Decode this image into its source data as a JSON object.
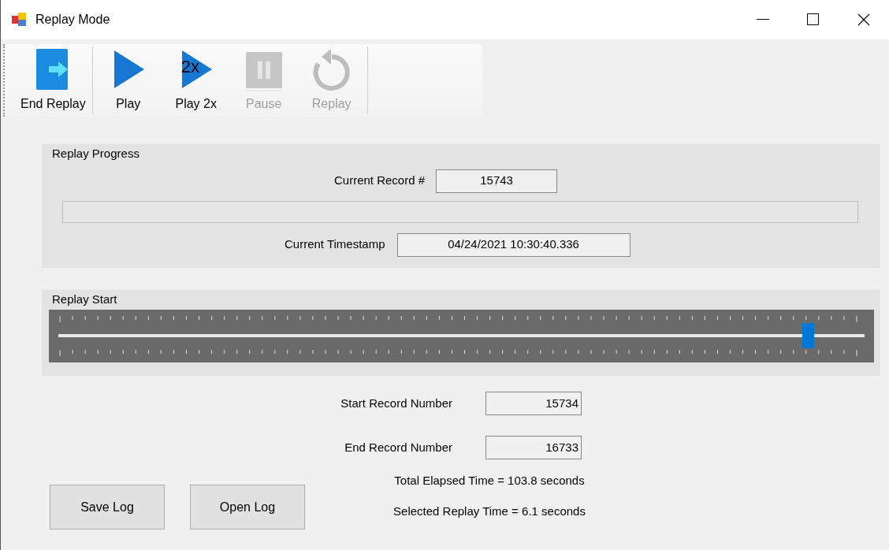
{
  "window": {
    "title": "Replay Mode"
  },
  "toolbar": [
    {
      "kind": "exit",
      "label": "End Replay",
      "disabled": false
    },
    {
      "kind": "play",
      "label": "Play",
      "disabled": false
    },
    {
      "kind": "fast",
      "label": "Play 2x",
      "icon_text": "2x",
      "disabled": false
    },
    {
      "kind": "pause",
      "label": "Pause",
      "disabled": true
    },
    {
      "kind": "replay",
      "label": "Replay",
      "disabled": true
    }
  ],
  "replay_progress": {
    "title": "Replay Progress",
    "current_record_label": "Current Record #",
    "current_record": "15743",
    "progress": {
      "level": 0
    },
    "current_timestamp_label": "Current Timestamp",
    "current_timestamp": "04/24/2021 10:30:40.336"
  },
  "replay_start": {
    "title": "Replay Start",
    "slider": {
      "level": 0.93
    }
  },
  "start_record_label": "Start Record Number",
  "start_record": "15734",
  "end_record_label": "End Record Number",
  "end_record": "16733",
  "buttons": [
    "Save Log",
    "Open Log"
  ],
  "total_elapsed": "Total Elapsed Time = 103.8 seconds",
  "selected_replay": "Selected Replay Time = 6.1 seconds"
}
